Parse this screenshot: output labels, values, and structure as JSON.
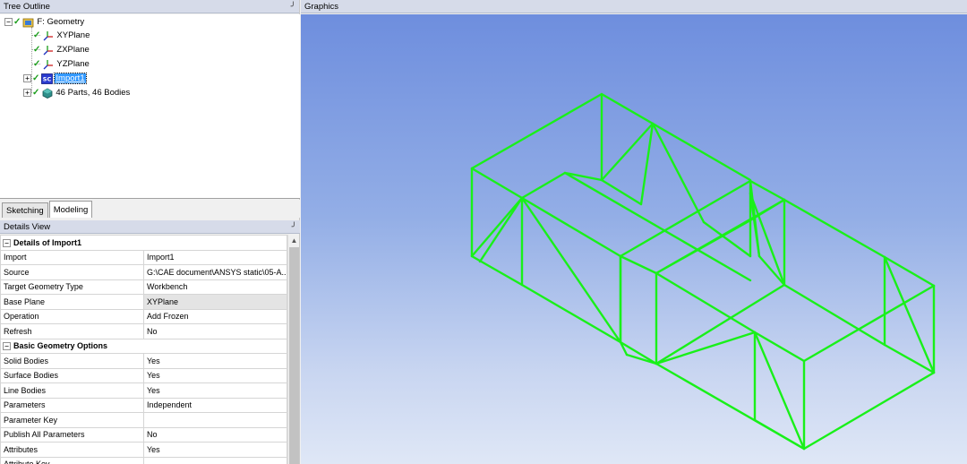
{
  "tree_outline": {
    "title": "Tree Outline",
    "pin": "ₕ",
    "nodes": [
      {
        "label": "F: Geometry",
        "expander": "−"
      },
      {
        "label": "XYPlane"
      },
      {
        "label": "ZXPlane"
      },
      {
        "label": "YZPlane"
      },
      {
        "label": "Import1",
        "expander": "+"
      },
      {
        "label": "46 Parts, 46 Bodies",
        "expander": "+"
      }
    ]
  },
  "tabs": [
    {
      "label": "Sketching"
    },
    {
      "label": "Modeling"
    }
  ],
  "details_view": {
    "title": "Details View",
    "groups": [
      {
        "title": "Details of Import1",
        "rows": [
          {
            "name": "Import",
            "value": "Import1"
          },
          {
            "name": "Source",
            "value": "G:\\CAE document\\ANSYS static\\05-A..."
          },
          {
            "name": "Target Geometry Type",
            "value": "Workbench"
          },
          {
            "name": "Base Plane",
            "value": "XYPlane"
          },
          {
            "name": "Operation",
            "value": "Add Frozen"
          },
          {
            "name": "Refresh",
            "value": "No"
          }
        ]
      },
      {
        "title": "Basic Geometry Options",
        "rows": [
          {
            "name": "Solid Bodies",
            "value": "Yes"
          },
          {
            "name": "Surface Bodies",
            "value": "Yes"
          },
          {
            "name": "Line Bodies",
            "value": "Yes"
          },
          {
            "name": "Parameters",
            "value": "Independent"
          },
          {
            "name": "Parameter Key",
            "value": ""
          },
          {
            "name": "Publish All Parameters",
            "value": "No"
          },
          {
            "name": "Attributes",
            "value": "Yes"
          },
          {
            "name": "Attribute Key",
            "value": ""
          }
        ]
      }
    ]
  },
  "graphics": {
    "title": "Graphics",
    "wire_color": "#19f019",
    "background_top": "#6e8ede",
    "background_bottom": "#dfe7f6"
  },
  "icons": {
    "plane": "plane-axes-icon",
    "geometry": "geometry-icon",
    "import": "import-sc-icon",
    "parts": "parts-bodies-icon"
  }
}
